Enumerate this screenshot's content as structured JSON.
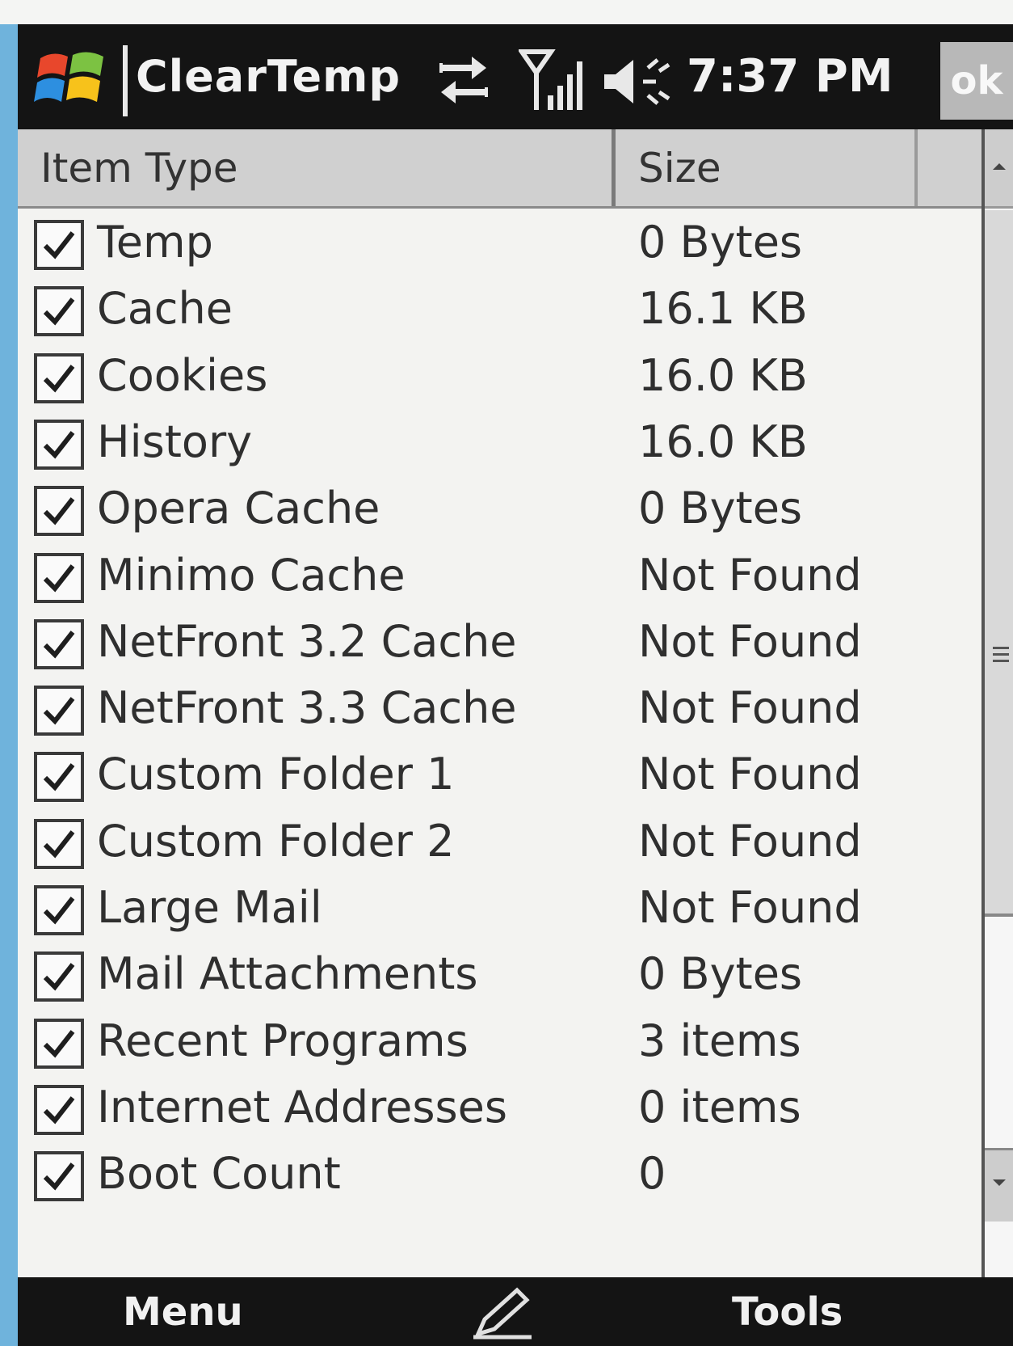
{
  "titlebar": {
    "app_title": "ClearTemp",
    "clock": "7:37 PM",
    "ok_label": "ok",
    "icons": [
      "windows-start-icon",
      "sync-icon",
      "signal-icon",
      "volume-icon"
    ]
  },
  "columns": {
    "item_type": "Item Type",
    "size": "Size"
  },
  "rows": [
    {
      "label": "Temp",
      "size": "0 Bytes",
      "checked": true
    },
    {
      "label": "Cache",
      "size": "16.1 KB",
      "checked": true
    },
    {
      "label": "Cookies",
      "size": "16.0 KB",
      "checked": true
    },
    {
      "label": "History",
      "size": "16.0 KB",
      "checked": true
    },
    {
      "label": "Opera Cache",
      "size": "0 Bytes",
      "checked": true
    },
    {
      "label": "Minimo Cache",
      "size": "Not Found",
      "checked": true
    },
    {
      "label": "NetFront 3.2 Cache",
      "size": "Not Found",
      "checked": true
    },
    {
      "label": "NetFront 3.3 Cache",
      "size": "Not Found",
      "checked": true
    },
    {
      "label": "Custom Folder 1",
      "size": "Not Found",
      "checked": true
    },
    {
      "label": "Custom Folder 2",
      "size": "Not Found",
      "checked": true
    },
    {
      "label": "Large Mail",
      "size": "Not Found",
      "checked": true
    },
    {
      "label": "Mail Attachments",
      "size": "0 Bytes",
      "checked": true
    },
    {
      "label": "Recent Programs",
      "size": "3 items",
      "checked": true
    },
    {
      "label": "Internet Addresses",
      "size": "0 items",
      "checked": true
    },
    {
      "label": "Boot Count",
      "size": "0",
      "checked": true
    }
  ],
  "menubar": {
    "menu_label": "Menu",
    "tools_label": "Tools",
    "center_icon": "pencil-icon"
  },
  "colors": {
    "bar_background": "#141414",
    "list_background": "#f3f3f1",
    "header_background": "#d0d0d0",
    "desktop_background": "#6fb3dc"
  }
}
